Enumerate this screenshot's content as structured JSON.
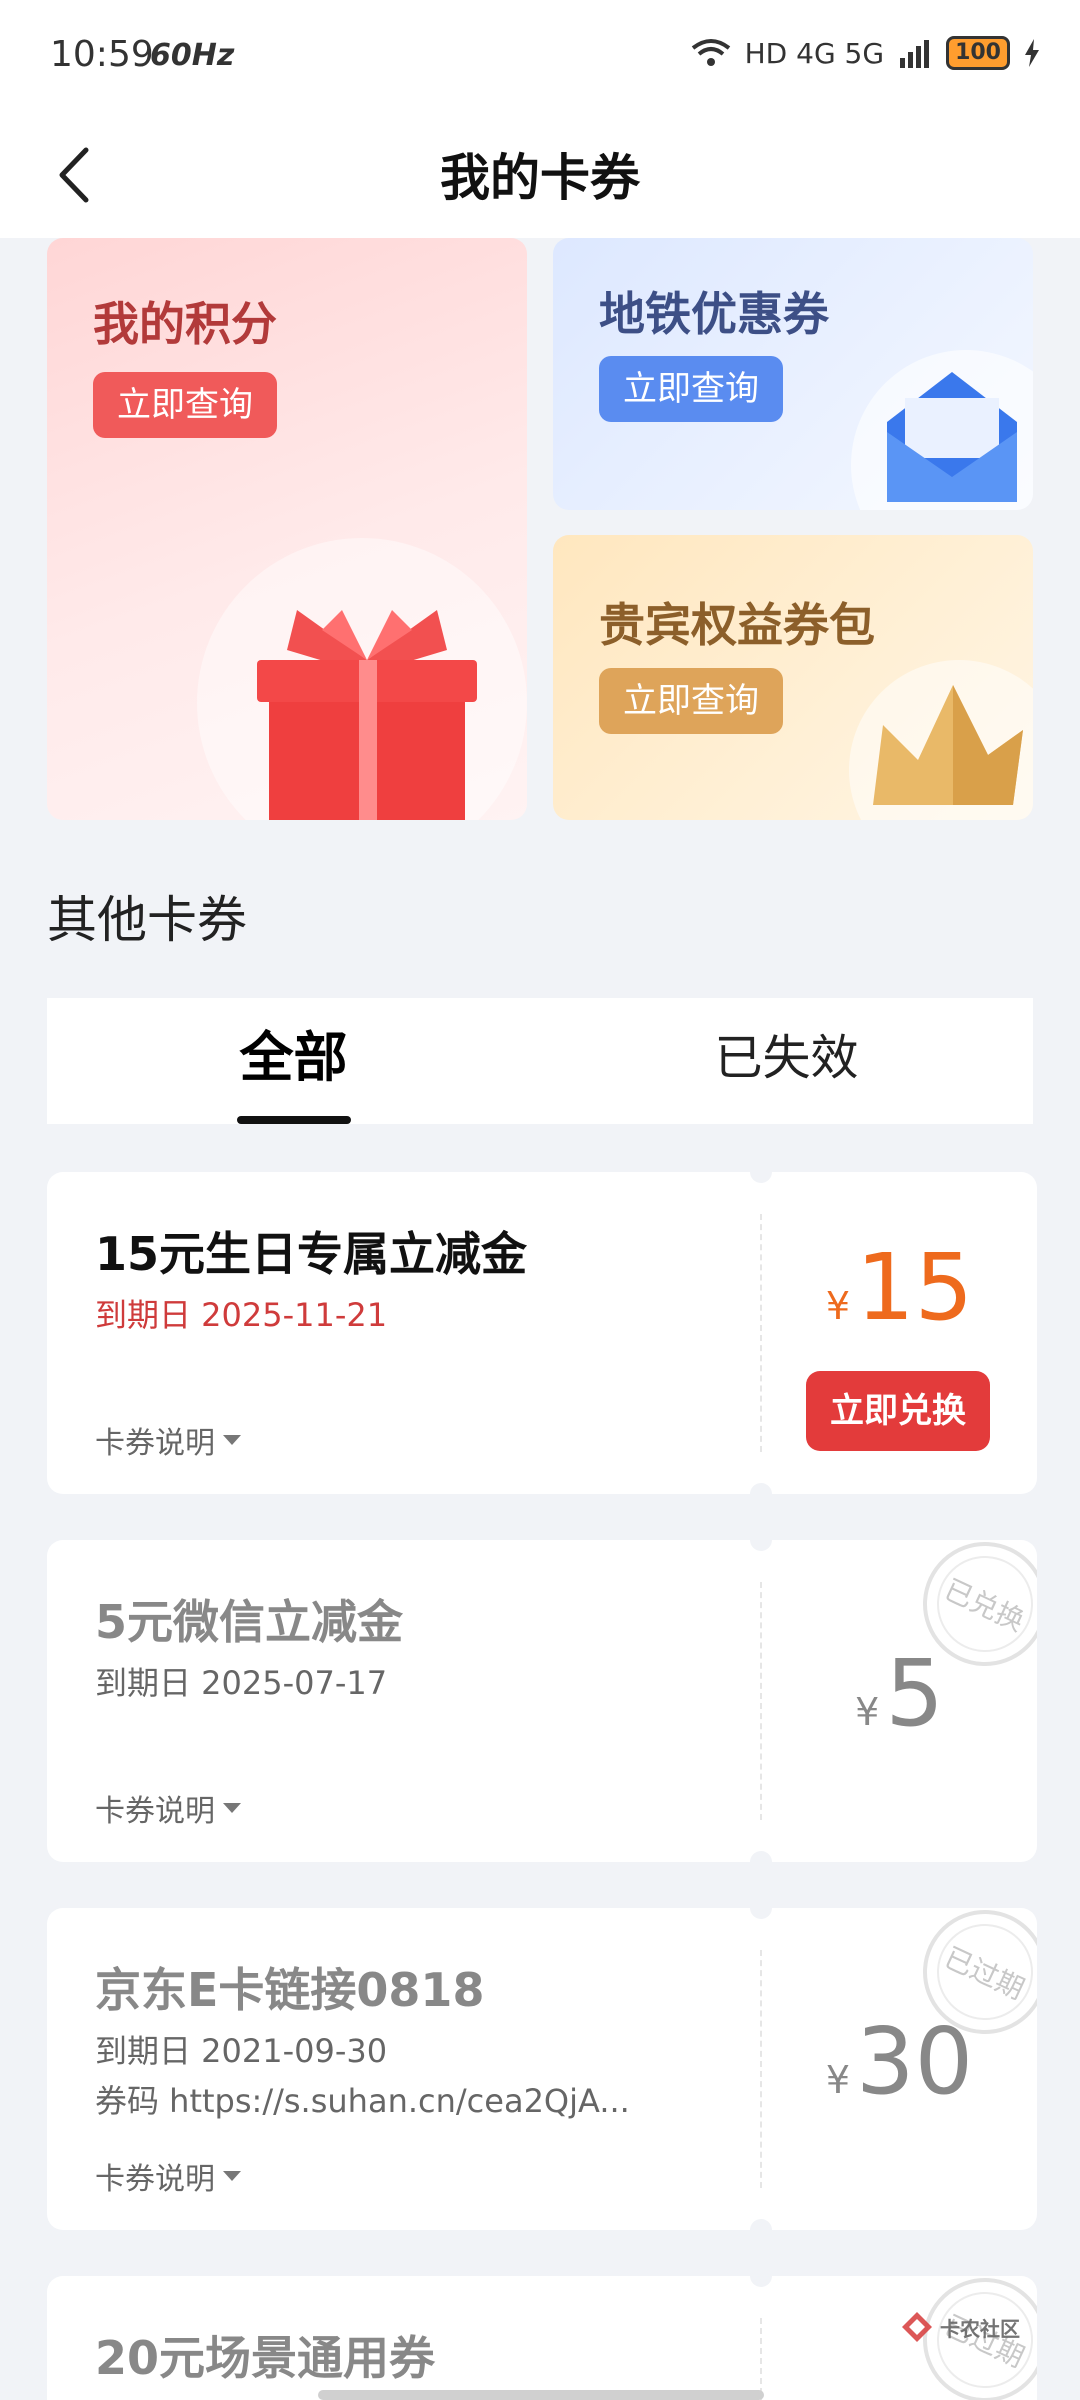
{
  "status_bar": {
    "time": "10:59",
    "refresh_rate": "60Hz",
    "network": "HD 4G 5G",
    "battery": "100"
  },
  "header": {
    "title": "我的卡券"
  },
  "promos": {
    "points": {
      "title": "我的积分",
      "button": "立即查询"
    },
    "metro": {
      "title": "地铁优惠券",
      "button": "立即查询"
    },
    "vip": {
      "title": "贵宾权益券包",
      "button": "立即查询"
    }
  },
  "section": {
    "title": "其他卡券"
  },
  "tabs": [
    {
      "label": "全部",
      "active": true
    },
    {
      "label": "已失效",
      "active": false
    }
  ],
  "coupons": [
    {
      "name": "15元生日专属立减金",
      "expiry": "到期日 2025-11-21",
      "desc": "卡券说明",
      "currency": "¥",
      "amount": "15",
      "action": "立即兑换"
    },
    {
      "name": "5元微信立减金",
      "expiry": "到期日 2025-07-17",
      "desc": "卡券说明",
      "currency": "¥",
      "amount": "5",
      "stamp": "已兑换"
    },
    {
      "name": "京东E卡链接0818",
      "expiry": "到期日 2021-09-30",
      "code": "券码  https://s.suhan.cn/cea2QjA...",
      "desc": "卡券说明",
      "currency": "¥",
      "amount": "30",
      "stamp": "已过期"
    },
    {
      "name": "20元场景通用券",
      "stamp": "已过期"
    }
  ],
  "watermark": "卡农社区",
  "colors": {
    "accent_red": "#e33b3b",
    "amount_orange": "#ee6a1d",
    "background": "#f1f3f7"
  }
}
